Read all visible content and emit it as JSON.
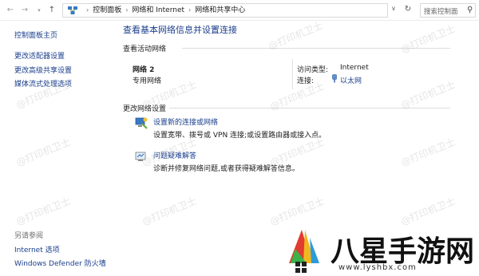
{
  "address_bar": {
    "breadcrumbs": [
      "控制面板",
      "网络和 Internet",
      "网络和共享中心"
    ],
    "search_placeholder": "搜索控制面"
  },
  "sidebar": {
    "home": "控制面板主页",
    "links": [
      "更改适配器设置",
      "更改高级共享设置",
      "媒体流式处理选项"
    ],
    "see_also_label": "另请参阅",
    "see_also_links": [
      "Internet 选项",
      "Windows Defender 防火墙"
    ]
  },
  "main": {
    "title": "查看基本网络信息并设置连接",
    "active_section_label": "查看活动网络",
    "network": {
      "name": "网络 2",
      "type": "专用网络",
      "access_type_label": "访问类型:",
      "access_type_value": "Internet",
      "connections_label": "连接:",
      "connections_value": "以太网"
    },
    "change_section_label": "更改网络设置",
    "settings": [
      {
        "link": "设置新的连接或网络",
        "desc": "设置宽带、拨号或 VPN 连接;或设置路由器或接入点。"
      },
      {
        "link": "问题疑难解答",
        "desc": "诊断并修复网络问题,或者获得疑难解答信息。"
      }
    ]
  },
  "watermark": "@打印机卫士",
  "logo": {
    "text": "八星手游网",
    "domain": "www.lyshbx.com"
  }
}
